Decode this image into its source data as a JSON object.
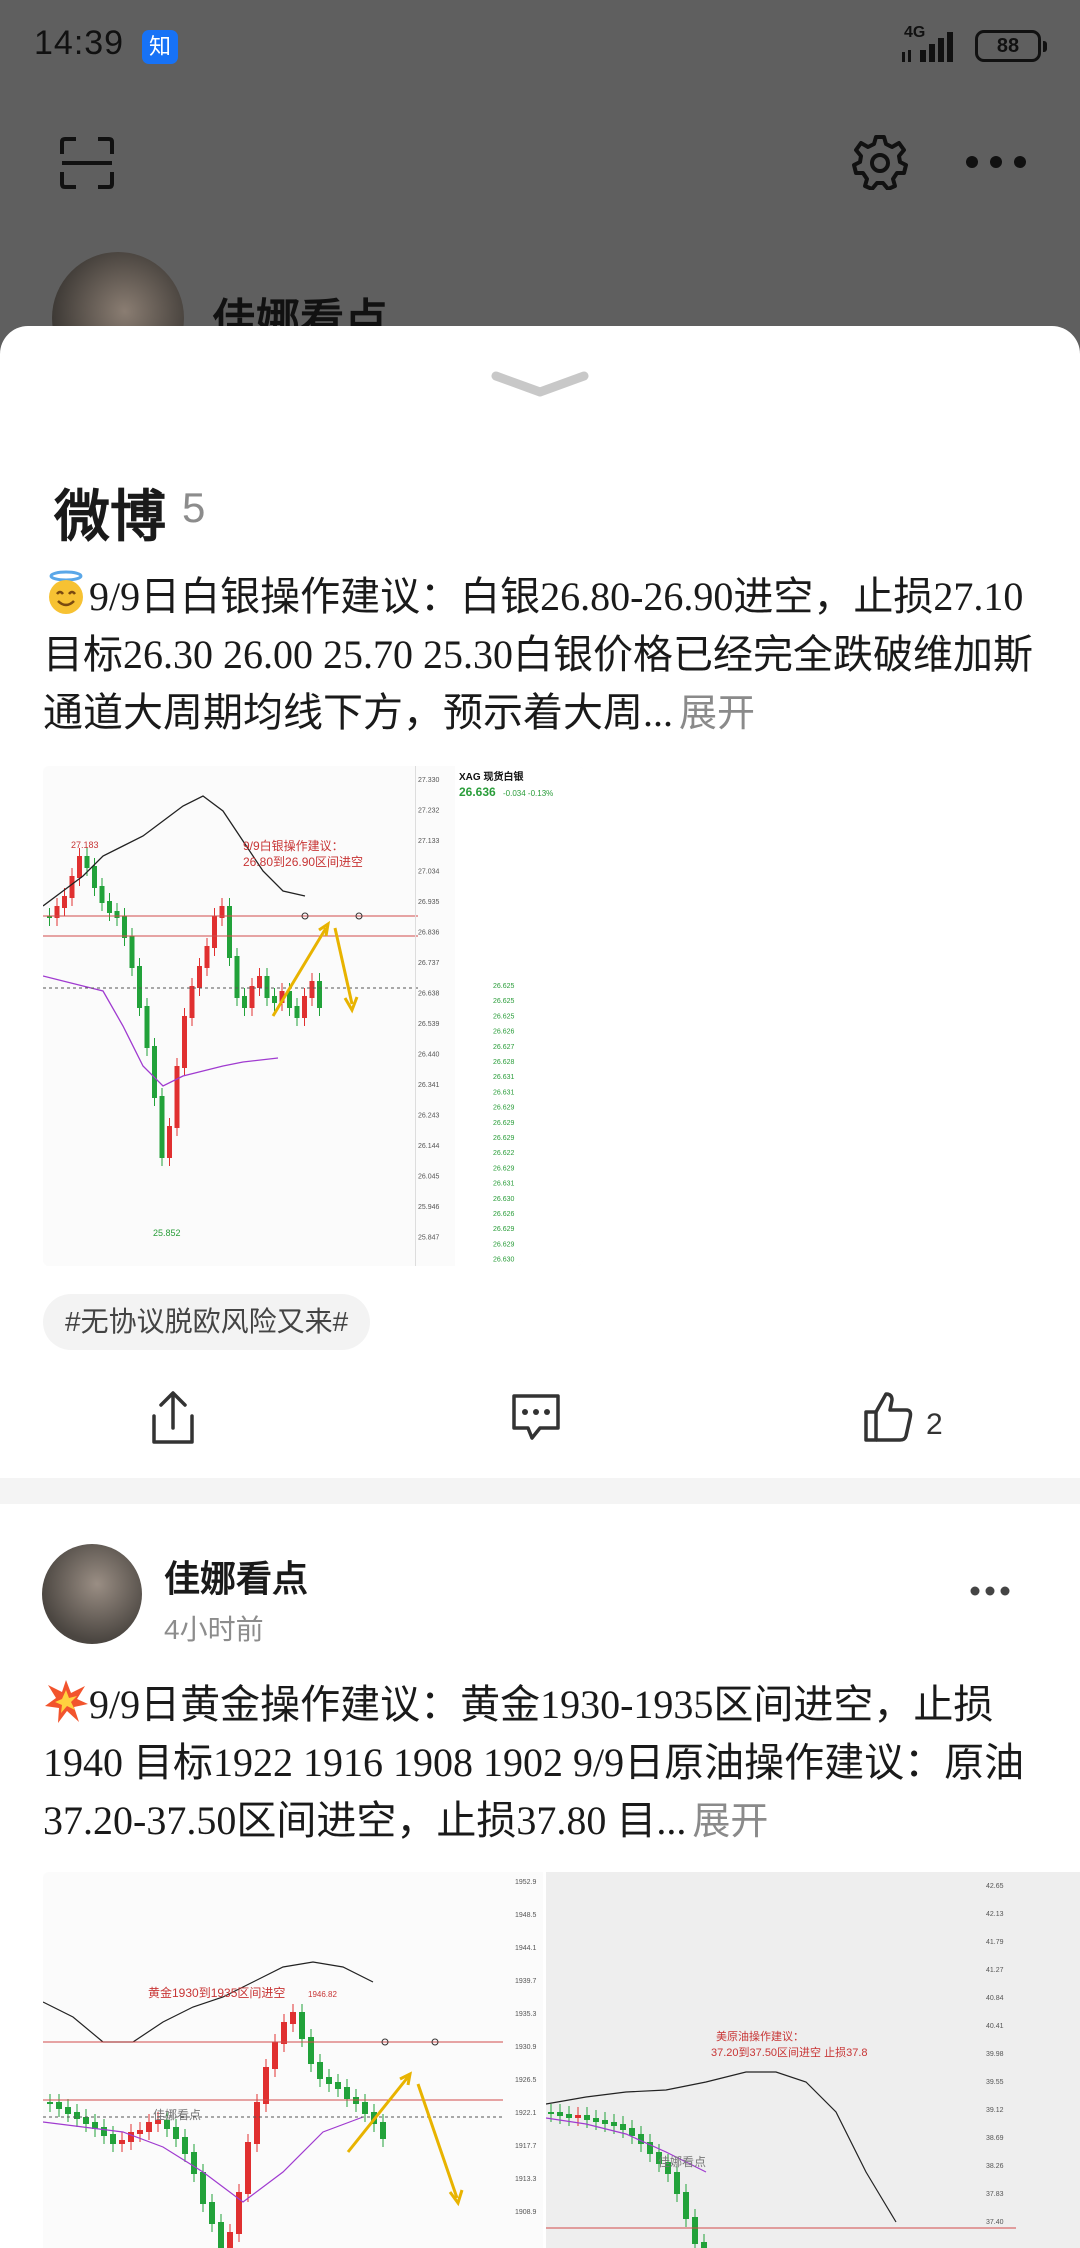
{
  "status_bar": {
    "time": "14:39",
    "app_badge": "知",
    "network": "4G",
    "battery": "88"
  },
  "profile_backdrop": {
    "name": "佳娜看点"
  },
  "sheet": {
    "section_title": "微博",
    "section_count": "5",
    "posts": [
      {
        "text": "9/9日白银操作建议：白银26.80-26.90进空，止损27.10 目标26.30 26.00 25.70 25.30白银价格已经完全跌破维加斯通道大周期均线下方，预示着大周...",
        "expand": "展开",
        "tag": "#无协议脱欧风险又来#",
        "like_count": "2",
        "chart": {
          "annotation_line1": "9/9白银操作建议：",
          "annotation_line2": "26.80到26.90区间进空",
          "high_label": "27.183",
          "low_label": "25.852",
          "side_title": "XAG 现货白银",
          "side_price": "26.636",
          "side_change": "-0.034   -0.13%",
          "prices": [
            "27.330",
            "27.232",
            "27.133",
            "27.034",
            "26.935",
            "26.836",
            "26.737",
            "26.638",
            "26.539",
            "26.440",
            "26.341",
            "26.243",
            "26.144",
            "26.045",
            "25.946",
            "25.847"
          ]
        }
      },
      {
        "author": "佳娜看点",
        "time": "4小时前",
        "text": "9/9日黄金操作建议：黄金1930-1935区间进空，止损1940 目标1922 1916 1908 1902 9/9日原油操作建议：原油37.20-37.50区间进空，止损37.80 目...",
        "expand": "展开",
        "chart_gold": {
          "annotation": "黄金1930到1935区间进空",
          "watermark": "佳娜看点",
          "high_label": "1946.82",
          "prices": [
            "1952.9",
            "1948.5",
            "1944.1",
            "1939.7",
            "1935.3",
            "1930.9",
            "1926.5",
            "1922.1",
            "1917.7",
            "1913.3",
            "1908.9"
          ]
        },
        "chart_oil": {
          "annotation_line1": "美原油操作建议：",
          "annotation_line2": "37.20到37.50区间进空   止损37.8",
          "watermark": "佳娜看点",
          "prices": [
            "42.65",
            "42.13",
            "41.79",
            "41.27",
            "40.84",
            "40.41",
            "39.98",
            "39.55",
            "39.12",
            "38.69",
            "38.26",
            "37.83",
            "37.40"
          ]
        }
      }
    ]
  }
}
